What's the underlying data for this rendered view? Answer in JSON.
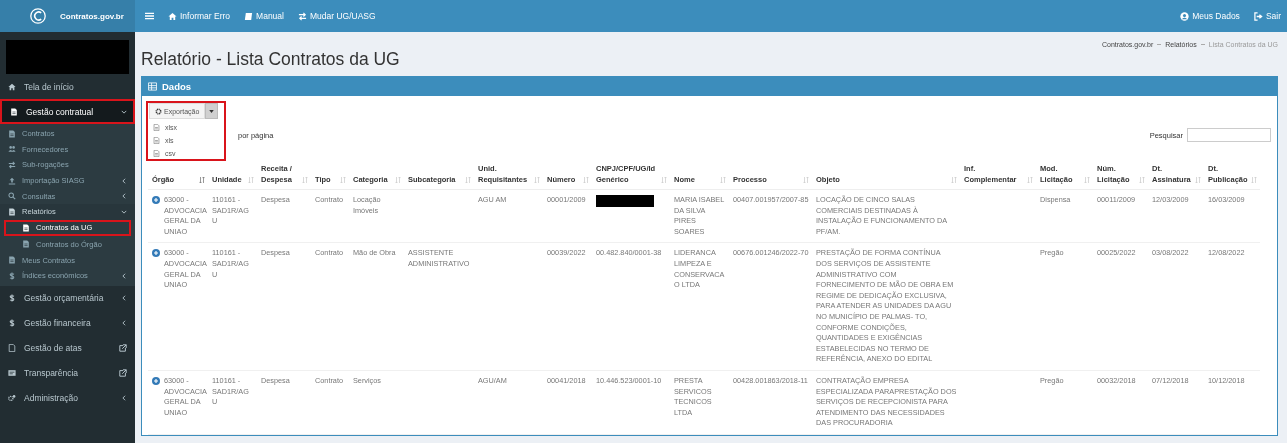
{
  "topbar": {
    "brand": "Contratos.gov.br",
    "links": [
      {
        "label": "Informar Erro"
      },
      {
        "label": "Manual"
      },
      {
        "label": "Mudar UG/UASG"
      }
    ],
    "user_links": [
      {
        "label": "Meus Dados"
      },
      {
        "label": "Sair"
      }
    ]
  },
  "sidebar": {
    "items": [
      {
        "label": "Tela de início",
        "selected": false,
        "highlighted": false,
        "expanded": false
      },
      {
        "label": "Gestão contratual",
        "selected": true,
        "highlighted": true,
        "expanded": true,
        "children": [
          {
            "label": "Contratos",
            "selected": false,
            "highlighted": false,
            "expanded": false
          },
          {
            "label": "Fornecedores",
            "selected": false,
            "highlighted": false,
            "expanded": false
          },
          {
            "label": "Sub-rogações",
            "selected": false,
            "highlighted": false,
            "expanded": false
          },
          {
            "label": "Importação SIASG",
            "selected": false,
            "highlighted": false,
            "expanded": false
          },
          {
            "label": "Consultas",
            "selected": false,
            "highlighted": false,
            "expanded": false
          },
          {
            "label": "Relatórios",
            "selected": true,
            "highlighted": false,
            "expanded": true,
            "children": [
              {
                "label": "Contratos da UG",
                "selected": true,
                "highlighted": true
              },
              {
                "label": "Contratos do Órgão",
                "selected": false,
                "highlighted": false
              }
            ]
          },
          {
            "label": "Meus Contratos",
            "selected": false,
            "highlighted": false,
            "expanded": false
          },
          {
            "label": "Índices econômicos",
            "selected": false,
            "highlighted": false,
            "expanded": false
          }
        ]
      },
      {
        "label": "Gestão orçamentária",
        "selected": false,
        "highlighted": false,
        "expanded": false
      },
      {
        "label": "Gestão financeira",
        "selected": false,
        "highlighted": false,
        "expanded": false
      },
      {
        "label": "Gestão de atas",
        "selected": false,
        "highlighted": false,
        "expanded": false
      },
      {
        "label": "Transparência",
        "selected": false,
        "highlighted": false,
        "expanded": false
      },
      {
        "label": "Administração",
        "selected": false,
        "highlighted": false,
        "expanded": false
      }
    ]
  },
  "page_title": "Relatório - Lista Contratos da UG",
  "breadcrumb": [
    "Contratos.gov.br",
    "Relatórios",
    "Lista Contratos da UG"
  ],
  "panel": {
    "title": "Dados",
    "export": {
      "label": "Exportação",
      "expanded": true,
      "highlighted": true,
      "options": [
        "xlsx",
        "xls",
        "csv"
      ]
    },
    "page_size_suffix": "por página",
    "search": {
      "label": "Pesquisar"
    },
    "columns": [
      {
        "label": "Órgão",
        "sorted": true
      },
      {
        "label": "Unidade",
        "sorted": false
      },
      {
        "label": "Receita / Despesa",
        "sorted": false
      },
      {
        "label": "Tipo",
        "sorted": false
      },
      {
        "label": "Categoria",
        "sorted": false
      },
      {
        "label": "Subcategoria",
        "sorted": false
      },
      {
        "label": "Unid. Requisitantes",
        "sorted": false
      },
      {
        "label": "Número",
        "sorted": false
      },
      {
        "label": "CNPJ/CPF/UG/Id Genérico",
        "sorted": false
      },
      {
        "label": "Nome",
        "sorted": false
      },
      {
        "label": "Processo",
        "sorted": false
      },
      {
        "label": "Objeto",
        "sorted": false
      },
      {
        "label": "Inf. Complementar",
        "sorted": false
      },
      {
        "label": "Mod. Licitação",
        "sorted": false
      },
      {
        "label": "Núm. Licitação",
        "sorted": false
      },
      {
        "label": "Dt. Assinatura",
        "sorted": false
      },
      {
        "label": "Dt. Publicação",
        "sorted": false
      }
    ],
    "rows": [
      {
        "orgao": "63000 - ADVOCACIA GERAL DA UNIAO",
        "unidade": "110161 - SAD1R/AGU",
        "receita_despesa": "Despesa",
        "tipo": "Contrato",
        "categoria": "Locação Imóveis",
        "unid_requisitantes": "AGU AM",
        "numero": "00001/2009",
        "cnpj_redacted": true,
        "nome": "MARIA ISABEL DA SILVA PIRES SOARES",
        "processo": "00407.001957/2007-85",
        "objeto": "LOCAÇÃO DE CINCO SALAS COMERCIAIS DESTINADAS À INSTALAÇÃO E FUNCIONAMENTO DA PF/AM.",
        "mod_licitacao": "Dispensa",
        "num_licitacao": "00011/2009",
        "dt_assinatura": "12/03/2009",
        "dt_publicacao": "16/03/2009"
      },
      {
        "orgao": "63000 - ADVOCACIA GERAL DA UNIAO",
        "unidade": "110161 - SAD1R/AGU",
        "receita_despesa": "Despesa",
        "tipo": "Contrato",
        "categoria": "Mão de Obra",
        "subcategoria": "ASSISTENTE ADMINISTRATIVO",
        "numero": "00039/2022",
        "cnpj_generico": "00.482.840/0001-38",
        "nome": "LIDERANCA LIMPEZA E CONSERVACAO LTDA",
        "processo": "00676.001246/2022-70",
        "objeto": "PRESTAÇÃO DE FORMA CONTÍNUA DOS SERVIÇOS DE ASSISTENTE ADMINISTRATIVO COM FORNECIMENTO DE MÃO DE OBRA EM REGIME DE DEDICAÇÃO EXCLUSIVA, PARA ATENDER AS UNIDADES DA AGU NO MUNICÍPIO DE PALMAS- TO, CONFORME CONDIÇÕES, QUANTIDADES E EXIGÊNCIAS ESTABELECIDAS NO TERMO DE REFERÊNCIA, ANEXO DO EDITAL",
        "mod_licitacao": "Pregão",
        "num_licitacao": "00025/2022",
        "dt_assinatura": "03/08/2022",
        "dt_publicacao": "12/08/2022"
      },
      {
        "orgao": "63000 - ADVOCACIA GERAL DA UNIAO",
        "unidade": "110161 - SAD1R/AGU",
        "receita_despesa": "Despesa",
        "tipo": "Contrato",
        "categoria": "Serviços",
        "unid_requisitantes": "AGU/AM",
        "numero": "00041/2018",
        "cnpj_generico": "10.446.523/0001-10",
        "nome": "PRESTA SERVICOS TECNICOS LTDA",
        "processo": "00428.001863/2018-11",
        "objeto": "CONTRATAÇÃO EMPRESA ESPECIALIZADA PARAPRESTAÇÃO DOS SERVIÇOS DE RECEPCIONISTA PARA ATENDIMENTO DAS NECESSIDADES DAS PROCURADORIA",
        "mod_licitacao": "Pregão",
        "num_licitacao": "00032/2018",
        "dt_assinatura": "07/12/2018",
        "dt_publicacao": "10/12/2018"
      }
    ]
  }
}
